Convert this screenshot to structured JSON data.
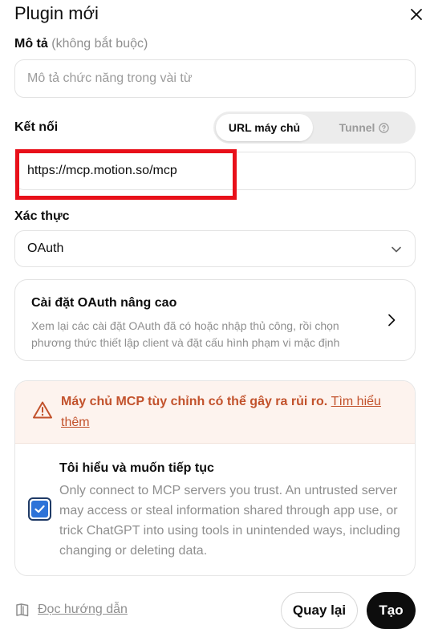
{
  "header": {
    "title": "Plugin mới"
  },
  "description": {
    "label": "Mô tả",
    "optional": "(không bắt buộc)",
    "placeholder": "Mô tả chức năng trong vài từ",
    "value": ""
  },
  "connection": {
    "label": "Kết nối",
    "tabs": [
      {
        "label": "URL máy chủ",
        "active": true
      },
      {
        "label": "Tunnel",
        "active": false
      }
    ],
    "url_value": "https://mcp.motion.so/mcp"
  },
  "auth": {
    "label": "Xác thực",
    "selected": "OAuth"
  },
  "oauth_card": {
    "title": "Cài đặt OAuth nâng cao",
    "description": "Xem lại các cài đặt OAuth đã có hoặc nhập thủ công, rồi chọn phương thức thiết lập client và đặt cấu hình phạm vi mặc định"
  },
  "warning": {
    "text": "Máy chủ MCP tùy chỉnh có thể gây ra rủi ro.",
    "link": "Tìm hiểu thêm",
    "color": "#c2522c"
  },
  "acknowledge": {
    "title": "Tôi hiểu và muốn tiếp tục",
    "description": "Only connect to MCP servers you trust. An untrusted server may access or steal information shared through app use, or trick ChatGPT into using tools in unintended ways, including changing or deleting data.",
    "checked": true
  },
  "footer": {
    "guide": "Đọc hướng dẫn",
    "back": "Quay lại",
    "create": "Tạo"
  },
  "icons": {
    "close": "close-icon",
    "help": "question-circle-icon",
    "chevron_down": "chevron-down-icon",
    "chevron_right": "chevron-right-icon",
    "warning": "warning-triangle-icon",
    "check": "check-icon",
    "book": "book-icon"
  }
}
